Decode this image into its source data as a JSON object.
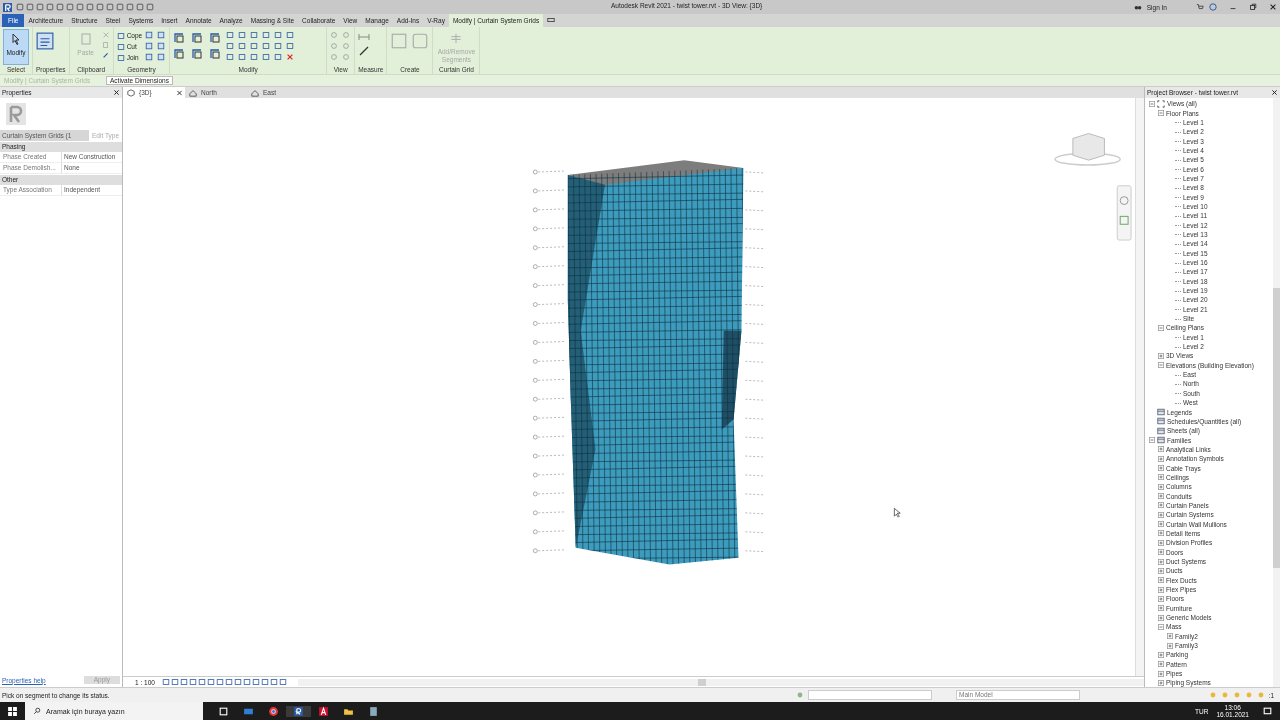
{
  "window": {
    "title": "Autodesk Revit 2021 - twist tower.rvt - 3D View: {3D}",
    "sign_in": "Sign In"
  },
  "ribbon_tabs": [
    {
      "label": "File",
      "kind": "file",
      "selected": false
    },
    {
      "label": "Architecture",
      "kind": "tab",
      "selected": false
    },
    {
      "label": "Structure",
      "kind": "tab",
      "selected": false
    },
    {
      "label": "Steel",
      "kind": "tab",
      "selected": false
    },
    {
      "label": "Systems",
      "kind": "tab",
      "selected": false
    },
    {
      "label": "Insert",
      "kind": "tab",
      "selected": false
    },
    {
      "label": "Annotate",
      "kind": "tab",
      "selected": false
    },
    {
      "label": "Analyze",
      "kind": "tab",
      "selected": false
    },
    {
      "label": "Massing & Site",
      "kind": "tab",
      "selected": false
    },
    {
      "label": "Collaborate",
      "kind": "tab",
      "selected": false
    },
    {
      "label": "View",
      "kind": "tab",
      "selected": false
    },
    {
      "label": "Manage",
      "kind": "tab",
      "selected": false
    },
    {
      "label": "Add-Ins",
      "kind": "tab",
      "selected": false
    },
    {
      "label": "V-Ray",
      "kind": "tab",
      "selected": false
    },
    {
      "label": "Modify | Curtain System Grids",
      "kind": "tab",
      "selected": true
    }
  ],
  "ribbon_groups": [
    {
      "label": "Select",
      "kind": "select",
      "buttons": [
        {
          "label": "Modify",
          "selected": true,
          "disabled": false
        }
      ]
    },
    {
      "label": "Properties",
      "kind": "properties"
    },
    {
      "label": "Clipboard",
      "kind": "clipboard",
      "buttons": [
        {
          "label": "Paste",
          "selected": false,
          "disabled": true
        }
      ]
    },
    {
      "label": "Geometry",
      "kind": "geometry",
      "buttons": [
        {
          "label": "Cope",
          "selected": false,
          "disabled": false
        },
        {
          "label": "Cut",
          "selected": false,
          "disabled": false
        },
        {
          "label": "Join",
          "selected": false,
          "disabled": false
        }
      ]
    },
    {
      "label": "Modify",
      "kind": "modify"
    },
    {
      "label": "View",
      "kind": "view"
    },
    {
      "label": "Measure",
      "kind": "measure"
    },
    {
      "label": "Create",
      "kind": "create"
    },
    {
      "label": "Curtain Grid",
      "kind": "curtain",
      "buttons": [
        {
          "label": "Add/Remove Segments",
          "selected": false,
          "disabled": true
        }
      ]
    }
  ],
  "options_bar": {
    "context": "Modify | Curtain System Grids",
    "button": "Activate Dimensions"
  },
  "properties": {
    "title": "Properties",
    "type_selector": "Curtain System Grids (1",
    "edit_type": "Edit Type",
    "sections": [
      {
        "name": "Phasing",
        "rows": [
          {
            "label": "Phase Created",
            "value": "New Construction"
          },
          {
            "label": "Phase Demolish...",
            "value": "None"
          }
        ]
      },
      {
        "name": "Other",
        "rows": [
          {
            "label": "Type Association",
            "value": "Independent"
          }
        ]
      }
    ],
    "help_link": "Properties help",
    "apply": "Apply"
  },
  "view_tabs": [
    {
      "label": "{3D}",
      "kind": "perspective",
      "selected": true
    },
    {
      "label": "North",
      "kind": "elevation",
      "selected": false
    },
    {
      "label": "East",
      "kind": "elevation",
      "selected": false
    }
  ],
  "view_control_bar": {
    "scale": "1 : 100"
  },
  "project_browser": {
    "title": "Project Browser - twist tower.rvt",
    "tree": [
      {
        "label": "Views (all)",
        "kind": "views",
        "expanded": true,
        "children": [
          {
            "label": "Floor Plans",
            "expanded": true,
            "children": [
              {
                "label": "Level 1"
              },
              {
                "label": "Level 2"
              },
              {
                "label": "Level 3"
              },
              {
                "label": "Level 4"
              },
              {
                "label": "Level 5"
              },
              {
                "label": "Level 6"
              },
              {
                "label": "Level 7"
              },
              {
                "label": "Level 8"
              },
              {
                "label": "Level 9"
              },
              {
                "label": "Level 10"
              },
              {
                "label": "Level 11"
              },
              {
                "label": "Level 12"
              },
              {
                "label": "Level 13"
              },
              {
                "label": "Level 14"
              },
              {
                "label": "Level 15"
              },
              {
                "label": "Level 16"
              },
              {
                "label": "Level 17"
              },
              {
                "label": "Level 18"
              },
              {
                "label": "Level 19"
              },
              {
                "label": "Level 20"
              },
              {
                "label": "Level 21"
              },
              {
                "label": "Site"
              }
            ]
          },
          {
            "label": "Ceiling Plans",
            "expanded": true,
            "children": [
              {
                "label": "Level 1"
              },
              {
                "label": "Level 2"
              }
            ]
          },
          {
            "label": "3D Views",
            "expanded": false
          },
          {
            "label": "Elevations (Building Elevation)",
            "expanded": true,
            "children": [
              {
                "label": "East"
              },
              {
                "label": "North"
              },
              {
                "label": "South"
              },
              {
                "label": "West"
              }
            ]
          }
        ]
      },
      {
        "label": "Legends",
        "kind": "legend"
      },
      {
        "label": "Schedules/Quantities (all)",
        "kind": "schedule"
      },
      {
        "label": "Sheets (all)",
        "kind": "sheet"
      },
      {
        "label": "Families",
        "kind": "families",
        "expanded": true,
        "children": [
          {
            "label": "Analytical Links",
            "expanded": false
          },
          {
            "label": "Annotation Symbols",
            "expanded": false
          },
          {
            "label": "Cable Trays",
            "expanded": false
          },
          {
            "label": "Ceilings",
            "expanded": false
          },
          {
            "label": "Columns",
            "expanded": false
          },
          {
            "label": "Conduits",
            "expanded": false
          },
          {
            "label": "Curtain Panels",
            "expanded": false
          },
          {
            "label": "Curtain Systems",
            "expanded": false
          },
          {
            "label": "Curtain Wall Mullions",
            "expanded": false
          },
          {
            "label": "Detail Items",
            "expanded": false
          },
          {
            "label": "Division Profiles",
            "expanded": false
          },
          {
            "label": "Doors",
            "expanded": false
          },
          {
            "label": "Duct Systems",
            "expanded": false
          },
          {
            "label": "Ducts",
            "expanded": false
          },
          {
            "label": "Flex Ducts",
            "expanded": false
          },
          {
            "label": "Flex Pipes",
            "expanded": false
          },
          {
            "label": "Floors",
            "expanded": false
          },
          {
            "label": "Furniture",
            "expanded": false
          },
          {
            "label": "Generic Models",
            "expanded": false
          },
          {
            "label": "Mass",
            "expanded": true,
            "children": [
              {
                "label": "Family2",
                "expanded": false
              },
              {
                "label": "Family3",
                "expanded": false
              }
            ]
          },
          {
            "label": "Parking",
            "expanded": false
          },
          {
            "label": "Pattern",
            "expanded": false
          },
          {
            "label": "Pipes",
            "expanded": false
          },
          {
            "label": "Piping Systems",
            "expanded": false
          }
        ]
      }
    ]
  },
  "status_bar": {
    "message": "Pick on segment to change its status.",
    "model": "Main Model",
    "filter_count": ":1"
  },
  "taskbar": {
    "search_placeholder": "Aramak için buraya yazın",
    "language": "TUR",
    "time": "13:06",
    "date": "16.01.2021"
  }
}
